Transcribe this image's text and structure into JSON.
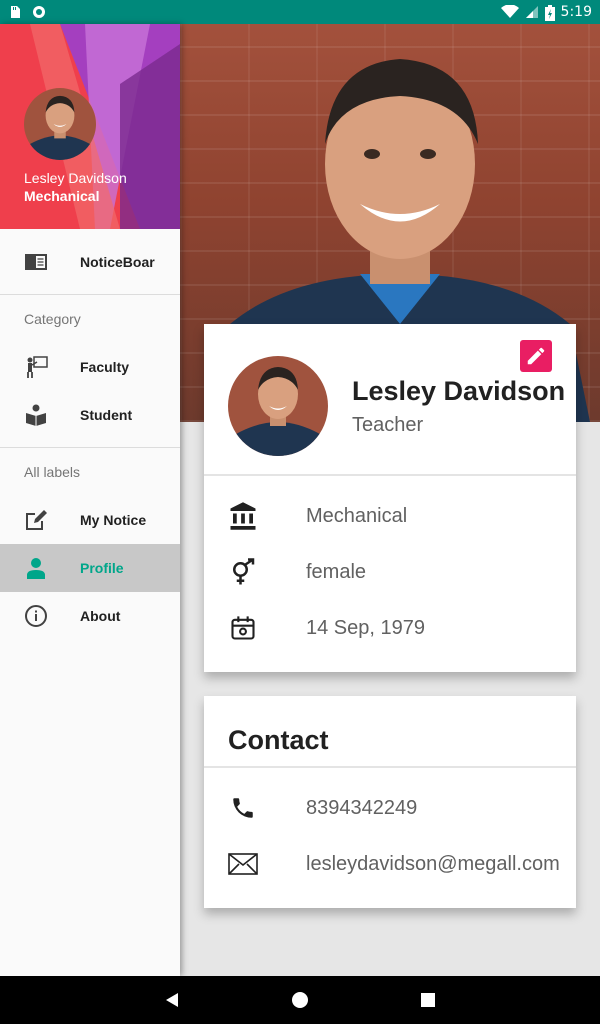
{
  "status_bar": {
    "time": "5:19"
  },
  "drawer": {
    "user_name": "Lesley Davidson",
    "user_department": "Mechanical",
    "top_items": [
      {
        "label": "NoticeBoar",
        "icon": "noticeboard-icon"
      }
    ],
    "category_header": "Category",
    "category_items": [
      {
        "label": "Faculty",
        "icon": "faculty-icon"
      },
      {
        "label": "Student",
        "icon": "student-icon"
      }
    ],
    "labels_header": "All labels",
    "label_items": [
      {
        "label": "My Notice",
        "icon": "edit-note-icon"
      },
      {
        "label": "Profile",
        "icon": "person-icon",
        "active": true
      },
      {
        "label": "About",
        "icon": "info-icon"
      }
    ]
  },
  "profile": {
    "name": "Lesley Davidson",
    "role": "Teacher",
    "department": "Mechanical",
    "gender": "female",
    "birth_date": "14 Sep, 1979"
  },
  "contact": {
    "title": "Contact",
    "phone": "8394342249",
    "email": "lesleydavidson@megall.com"
  },
  "colors": {
    "status_bar": "#00897b",
    "accent": "#00a68a",
    "edit_button": "#e91e63",
    "drawer_header": "#e53950"
  }
}
